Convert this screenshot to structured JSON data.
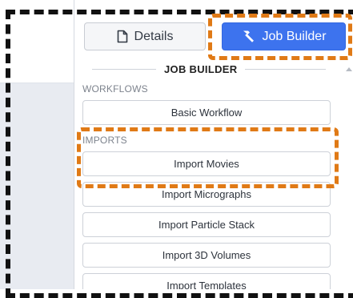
{
  "tabs": {
    "details_label": "Details",
    "job_builder_label": "Job Builder"
  },
  "panel": {
    "section_title": "JOB BUILDER",
    "categories": {
      "workflows": "WORKFLOWS",
      "imports": "IMPORTS"
    },
    "workflows": [
      "Basic Workflow"
    ],
    "imports": [
      "Import Movies",
      "Import Micrographs",
      "Import Particle Stack",
      "Import 3D Volumes",
      "Import Templates"
    ]
  },
  "colors": {
    "accent": "#3d73ee",
    "annotation_orange": "#e07a16",
    "annotation_black": "#111111"
  },
  "icons": {
    "details": "document-icon",
    "job_builder": "hammer-icon"
  }
}
